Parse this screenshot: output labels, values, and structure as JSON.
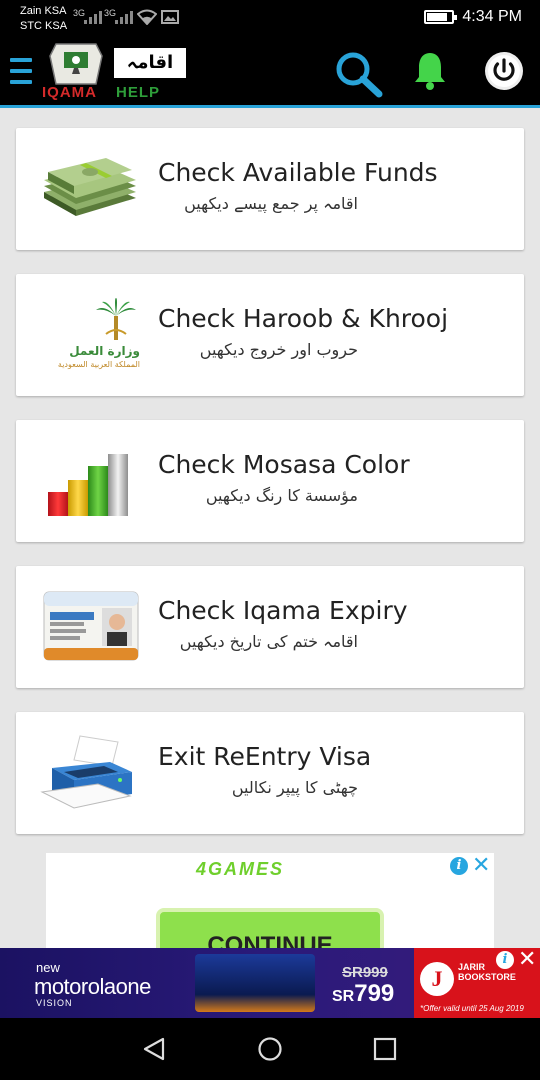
{
  "status_bar": {
    "carrier1": "Zain KSA",
    "carrier2": "STC KSA",
    "net1": "3G",
    "net2": "3G",
    "time": "4:34 PM",
    "battery_level": 0.85
  },
  "app_bar": {
    "logo_urdu": "اقامہ ہیلپ",
    "logo_word1": "IQAMA",
    "logo_word2": "HELP",
    "icons": [
      "menu-icon",
      "search-icon",
      "bell-icon",
      "power-icon"
    ],
    "accent_color": "#29a3d8"
  },
  "cards": [
    {
      "title": "Check Available Funds",
      "subtitle": "اقامہ پر جمع پیسے دیکھیں",
      "icon": "money-stack-icon"
    },
    {
      "title": "Check Haroob & Khrooj",
      "subtitle": "حروب اور خروج دیکھیں",
      "icon": "ministry-labor-logo",
      "logo_text1": "وزارة العمل",
      "logo_text2": "المملكة العربية السعودية"
    },
    {
      "title": "Check Mosasa Color",
      "subtitle": "مؤسسة کا رنگ دیکھیں",
      "icon": "color-bars-icon"
    },
    {
      "title": "Check Iqama Expiry",
      "subtitle": "اقامہ ختم کی تاریخ دیکھیں",
      "icon": "id-card-icon"
    },
    {
      "title": "Exit ReEntry Visa",
      "subtitle": "چھٹی کا پیپر نکالیں",
      "icon": "printer-icon"
    }
  ],
  "ad_top": {
    "brand": "4GAMES",
    "button": "CONTINUE"
  },
  "ad_bottom": {
    "new": "new",
    "brand": "motorolaone",
    "vision": "VISION",
    "old_price": "SR999",
    "currency": "SR",
    "price": "799",
    "store": "JARIR BOOKSTORE",
    "store_logo": "J",
    "offer": "*Offer valid until 25 Aug 2019"
  }
}
